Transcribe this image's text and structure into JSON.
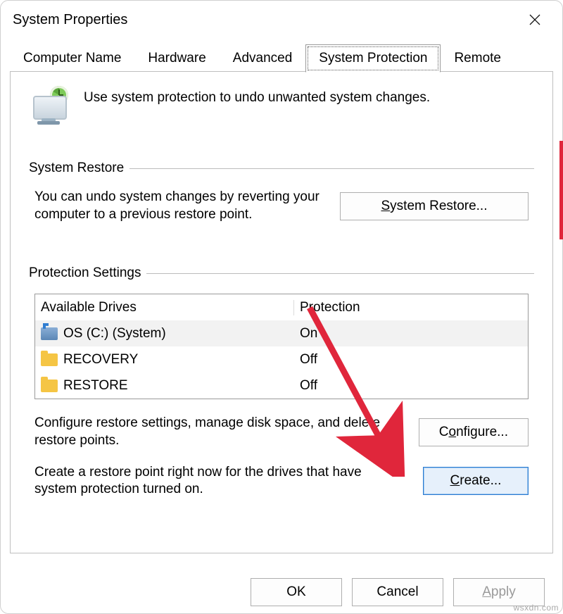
{
  "window": {
    "title": "System Properties"
  },
  "tabs": {
    "computer_name": "Computer Name",
    "hardware": "Hardware",
    "advanced": "Advanced",
    "system_protection": "System Protection",
    "remote": "Remote"
  },
  "intro": "Use system protection to undo unwanted system changes.",
  "restore": {
    "group": "System Restore",
    "text": "You can undo system changes by reverting your computer to a previous restore point.",
    "button": "System Restore..."
  },
  "protection": {
    "group": "Protection Settings",
    "col_drives": "Available Drives",
    "col_protection": "Protection",
    "rows": [
      {
        "name": "OS (C:) (System)",
        "status": "On"
      },
      {
        "name": "RECOVERY",
        "status": "Off"
      },
      {
        "name": "RESTORE",
        "status": "Off"
      }
    ],
    "configure_text": "Configure restore settings, manage disk space, and delete restore points.",
    "configure_button": "Configure...",
    "create_text": "Create a restore point right now for the drives that have system protection turned on.",
    "create_button": "Create..."
  },
  "buttons": {
    "ok": "OK",
    "cancel": "Cancel",
    "apply": "Apply"
  },
  "watermark": "wsxdn.com"
}
